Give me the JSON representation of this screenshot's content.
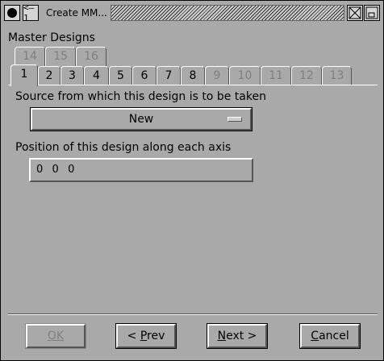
{
  "window": {
    "title": "Create MM...",
    "menu_glyph": "<–1"
  },
  "panel": {
    "group_label": "Master Designs",
    "tabs_row_back": [
      {
        "label": "14",
        "enabled": false
      },
      {
        "label": "15",
        "enabled": false
      },
      {
        "label": "16",
        "enabled": false
      }
    ],
    "tabs_row_front": [
      {
        "label": "1",
        "enabled": true,
        "selected": true
      },
      {
        "label": "2",
        "enabled": true
      },
      {
        "label": "3",
        "enabled": true
      },
      {
        "label": "4",
        "enabled": true
      },
      {
        "label": "5",
        "enabled": true
      },
      {
        "label": "6",
        "enabled": true
      },
      {
        "label": "7",
        "enabled": true
      },
      {
        "label": "8",
        "enabled": true
      },
      {
        "label": "9",
        "enabled": false
      },
      {
        "label": "10",
        "enabled": false
      },
      {
        "label": "11",
        "enabled": false
      },
      {
        "label": "12",
        "enabled": false
      },
      {
        "label": "13",
        "enabled": false
      }
    ],
    "source_label": "Source from which this design is to be taken",
    "source_value": "New",
    "position_label": "Position of this design along each axis",
    "position_value": "0  0  0"
  },
  "buttons": {
    "ok": {
      "label": "OK",
      "enabled": false
    },
    "prev": {
      "prefix": "< ",
      "mnemonic": "P",
      "rest": "rev"
    },
    "next": {
      "mnemonic": "N",
      "rest": "ext >"
    },
    "cancel": {
      "mnemonic": "C",
      "rest": "ancel"
    }
  }
}
